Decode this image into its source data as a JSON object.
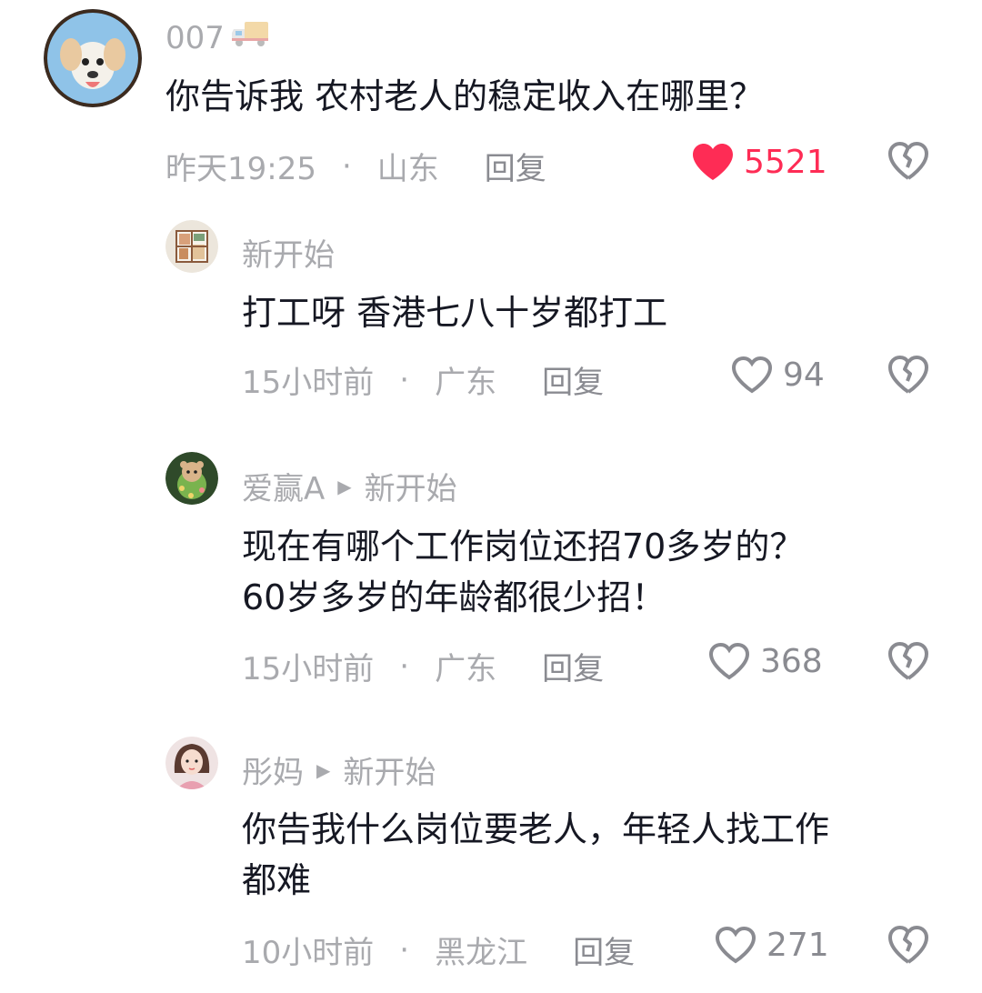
{
  "colors": {
    "like_active": "#fe2c55",
    "muted": "#a9aaae",
    "text": "#161823"
  },
  "comments": [
    {
      "username": "007",
      "badge_icon": "truck-icon",
      "text": "你告诉我 农村老人的稳定收入在哪里？",
      "time": "昨天19:25",
      "location": "山东",
      "reply_label": "回复",
      "likes": "5521",
      "liked": true
    },
    {
      "username": "新开始",
      "text": "打工呀 香港七八十岁都打工",
      "time": "15小时前",
      "location": "广东",
      "reply_label": "回复",
      "likes": "94",
      "liked": false
    },
    {
      "username": "爱赢A",
      "reply_to": "新开始",
      "text": "现在有哪个工作岗位还招70多岁的？\n60岁多岁的年龄都很少招！",
      "time": "15小时前",
      "location": "广东",
      "reply_label": "回复",
      "likes": "368",
      "liked": false
    },
    {
      "username": "彤妈",
      "reply_to": "新开始",
      "text": "你告我什么岗位要老人，年轻人找工作\n都难",
      "time": "10小时前",
      "location": "黑龙江",
      "reply_label": "回复",
      "likes": "271",
      "liked": false
    }
  ]
}
